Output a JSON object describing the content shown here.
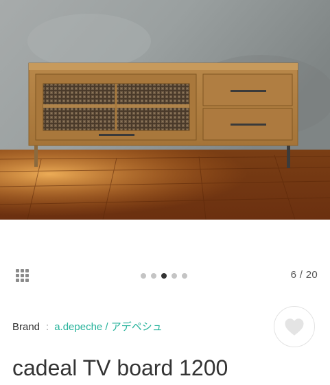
{
  "product": {
    "title": "cadeal TV board 1200",
    "brand_label": "Brand",
    "brand_separator": ":",
    "brand_name": "a.depeche / アデペシュ"
  },
  "gallery": {
    "counter": "6 / 20",
    "dots_total": 5,
    "dots_active": 3
  },
  "icons": {
    "grid": "grid-icon",
    "favorite": "heart-icon"
  },
  "colors": {
    "accent": "#25b29a",
    "text": "#333333"
  }
}
